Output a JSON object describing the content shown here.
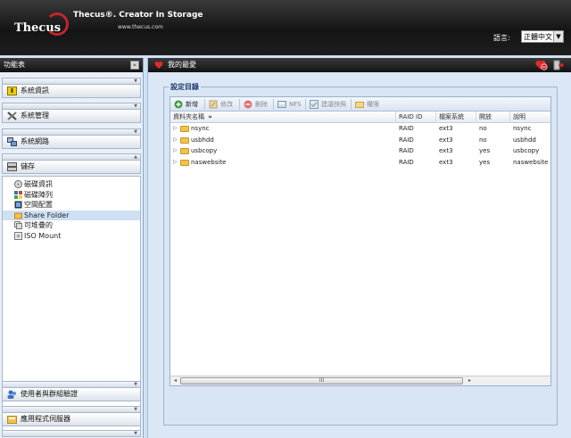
{
  "header": {
    "logo": "Thecus",
    "tagline": "Thecus®. Creator In Storage",
    "url": "www.thecus.com",
    "language_label": "語言:",
    "language_value": "正體中文"
  },
  "sidebar": {
    "title": "功能表",
    "sections": [
      {
        "label": "系統資訊",
        "icon": "info-icon"
      },
      {
        "label": "系統管理",
        "icon": "tools-icon"
      },
      {
        "label": "系統網路",
        "icon": "network-icon"
      },
      {
        "label": "儲存",
        "icon": "storage-icon"
      }
    ],
    "storage_items": [
      {
        "label": "磁碟資訊",
        "icon": "disk-info-icon"
      },
      {
        "label": "磁碟陣列",
        "icon": "raid-icon"
      },
      {
        "label": "空間配置",
        "icon": "space-icon"
      },
      {
        "label": "Share Folder",
        "icon": "share-folder-icon"
      },
      {
        "label": "可堆疊的",
        "icon": "stackable-icon"
      },
      {
        "label": "ISO Mount",
        "icon": "iso-mount-icon"
      }
    ],
    "bottom_sections": [
      {
        "label": "使用者與群組驗證",
        "icon": "users-icon"
      },
      {
        "label": "應用程式伺服器",
        "icon": "app-server-icon"
      }
    ]
  },
  "main": {
    "title": "我的最愛",
    "fieldset_title": "設定目錄",
    "toolbar": {
      "add": "新增",
      "edit": "修改",
      "delete": "刪除",
      "nfs": "NFS",
      "snapshot": "建議快照",
      "acl": "權限"
    },
    "columns": [
      "資料夾名稱",
      "RAID ID",
      "檔案系統",
      "開放",
      "說明"
    ],
    "column_sort_marker": "»",
    "rows": [
      {
        "name": "nsync",
        "raid": "RAID",
        "fs": "ext3",
        "public": "no",
        "desc": "nsync"
      },
      {
        "name": "usbhdd",
        "raid": "RAID",
        "fs": "ext3",
        "public": "no",
        "desc": "usbhdd"
      },
      {
        "name": "usbcopy",
        "raid": "RAID",
        "fs": "ext3",
        "public": "yes",
        "desc": "usbcopy"
      },
      {
        "name": "naswebsite",
        "raid": "RAID",
        "fs": "ext3",
        "public": "yes",
        "desc": "naswebsite"
      }
    ],
    "scroll_grip": "III"
  },
  "colors": {
    "header_bg": "#1a1a1a",
    "page_bg": "#cfe0f2",
    "accent_red": "#c0262e",
    "selected_bg": "#cfe0f4"
  }
}
